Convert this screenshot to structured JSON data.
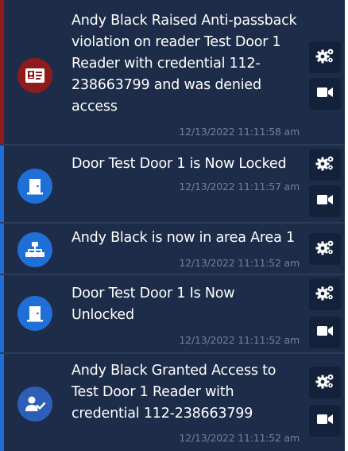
{
  "colors": {
    "panel_bg": "#1d2d49",
    "critical_accent": "#8e1b1b",
    "info_accent": "#1f6fd6",
    "icon_info_bg": "#1f6fd6",
    "icon_critical_bg": "#8e1b1b",
    "icon_user_bg": "#2d5fb8",
    "timestamp": "#6f7f9d",
    "text": "#ffffff"
  },
  "events": [
    {
      "icon": "id-card-icon",
      "message": "Andy Black Raised Anti-passback violation on reader Test Door 1 Reader with credential 112-238663799 and was denied access",
      "timestamp": "12/13/2022 11:11:58 am",
      "actions": [
        "gears-icon",
        "video-camera-icon"
      ]
    },
    {
      "icon": "door-icon",
      "message": "Door Test Door 1 is Now Locked",
      "timestamp": "12/13/2022 11:11:57 am",
      "actions": [
        "gears-icon",
        "video-camera-icon"
      ]
    },
    {
      "icon": "network-area-icon",
      "message": "Andy Black is now in area Area 1",
      "timestamp": "12/13/2022 11:11:52 am",
      "actions": [
        "gears-icon"
      ]
    },
    {
      "icon": "door-icon",
      "message": "Door Test Door 1 Is Now Unlocked",
      "timestamp": "12/13/2022 11:11:52 am",
      "actions": [
        "gears-icon",
        "video-camera-icon"
      ]
    },
    {
      "icon": "user-check-icon",
      "message": "Andy Black Granted Access to Test Door 1 Reader with credential 112-238663799",
      "timestamp": "12/13/2022 11:11:52 am",
      "actions": [
        "gears-icon",
        "video-camera-icon"
      ]
    }
  ]
}
